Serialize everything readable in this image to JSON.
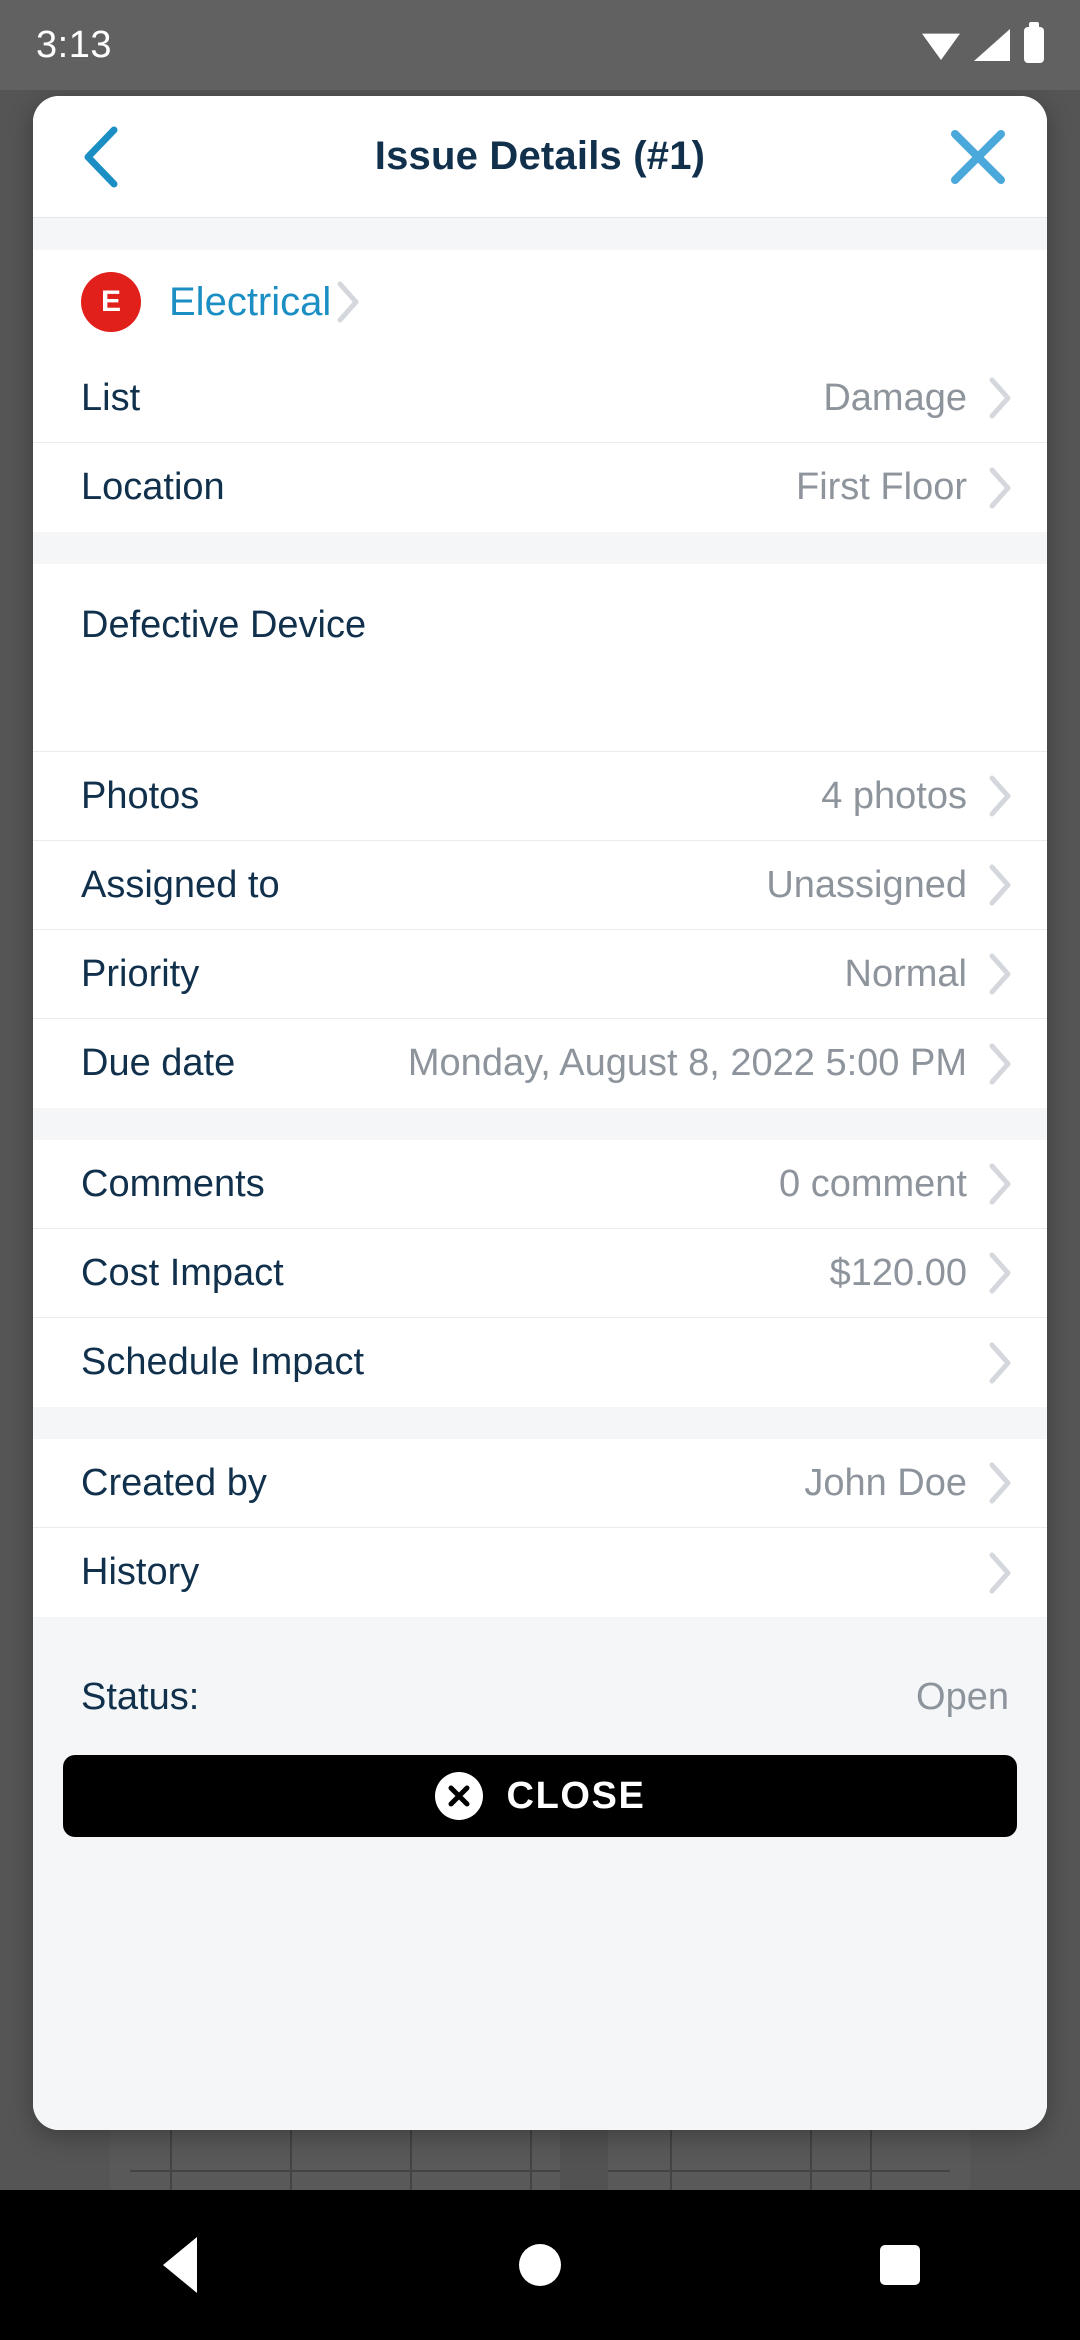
{
  "status_bar": {
    "time": "3:13",
    "icons": [
      "wifi-icon",
      "cellular-signal-icon",
      "battery-icon"
    ]
  },
  "header": {
    "back_icon": "chevron-left-icon",
    "title": "Issue Details (#1)",
    "close_icon": "close-x-icon"
  },
  "category": {
    "badge_letter": "E",
    "badge_color": "#e2201b",
    "label": "Electrical",
    "label_color": "#1b8fc4"
  },
  "sections": [
    {
      "rows": [
        {
          "label": "List",
          "value": "Damage",
          "chevron": true
        },
        {
          "label": "Location",
          "value": "First Floor",
          "chevron": true
        }
      ]
    },
    {
      "rows": [
        {
          "label": "Photos",
          "value": "4 photos",
          "chevron": true
        },
        {
          "label": "Assigned to",
          "value": "Unassigned",
          "chevron": true
        },
        {
          "label": "Priority",
          "value": "Normal",
          "chevron": true
        },
        {
          "label": "Due date",
          "value": "Monday, August 8, 2022 5:00 PM",
          "chevron": true
        }
      ]
    },
    {
      "rows": [
        {
          "label": "Comments",
          "value": "0 comment",
          "chevron": true
        },
        {
          "label": "Cost Impact",
          "value": "$120.00",
          "chevron": true
        },
        {
          "label": "Schedule Impact",
          "value": "",
          "chevron": true
        }
      ]
    },
    {
      "rows": [
        {
          "label": "Created by",
          "value": "John Doe",
          "chevron": true
        },
        {
          "label": "History",
          "value": "",
          "chevron": true
        }
      ]
    }
  ],
  "description": {
    "text": "Defective Device"
  },
  "status": {
    "label": "Status:",
    "value": "Open"
  },
  "close_button": {
    "label": "CLOSE",
    "icon": "close-circle-icon",
    "background": "#000000"
  },
  "nav_bar": {
    "back_icon": "triangle-back-icon",
    "home_icon": "circle-home-icon",
    "recents_icon": "square-recents-icon"
  }
}
